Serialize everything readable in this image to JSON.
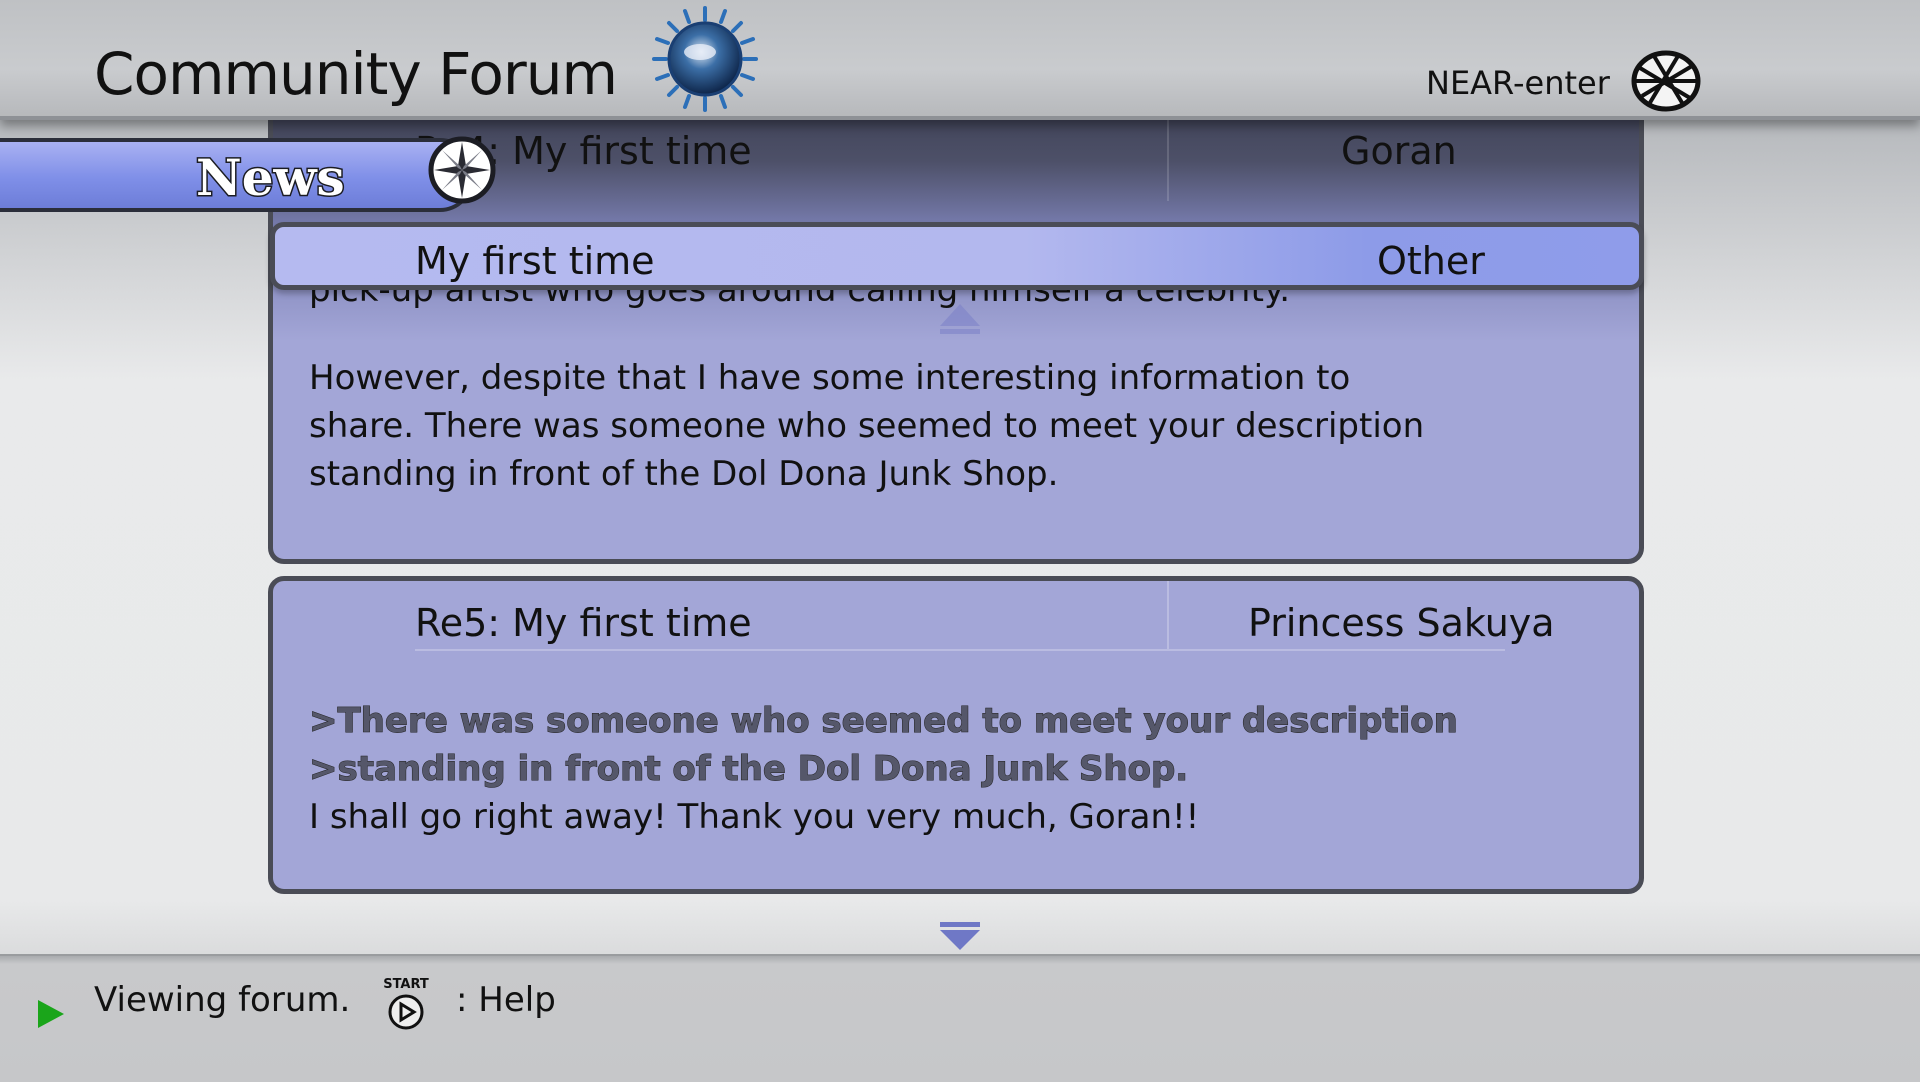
{
  "header": {
    "title": "Community Forum",
    "logo_icon": "globe-logo",
    "near_enter_label": "NEAR-enter",
    "network_icon": "network-globe-icon"
  },
  "sidebar": {
    "active_tab_label": "News",
    "tab_icon": "compass-icon"
  },
  "selected_thread": {
    "subject": "My first time",
    "category": "Other"
  },
  "posts": [
    {
      "subject": "Re4: My first time",
      "author": "Goran",
      "body_partial_line": "pick-up artist who goes around calling himself a celebrity.",
      "body_lines": [
        "However, despite that I have some interesting information to",
        "share. There was someone who seemed to meet your description",
        "standing in front of the Dol Dona Junk Shop."
      ]
    },
    {
      "subject": "Re5: My first time",
      "author": "Princess Sakuya",
      "quote_lines": [
        ">There was someone who seemed to meet your description",
        ">standing in front of the Dol Dona Junk Shop."
      ],
      "body_lines": [
        "I shall go right away! Thank you very much, Goran!!"
      ]
    }
  ],
  "footer": {
    "status_text": "Viewing forum.",
    "start_button_label": "START",
    "help_label": ": Help"
  },
  "colors": {
    "panel": "#a3a6d7",
    "selected_row": "#b5baf0",
    "news_tab": "#7f8fe8",
    "status_arrow": "#1aa51a"
  }
}
